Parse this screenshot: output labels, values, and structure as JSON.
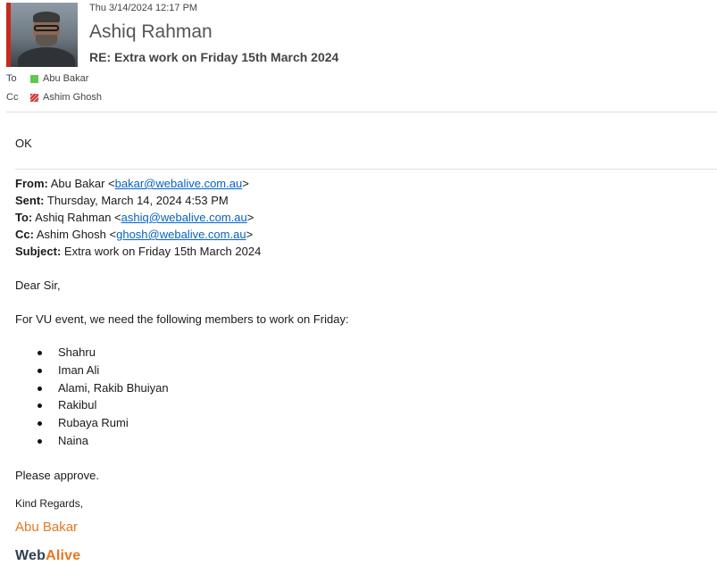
{
  "header": {
    "sent_date": "Thu 3/14/2024 12:17 PM",
    "sender_name": "Ashiq Rahman",
    "subject": "RE: Extra work on Friday 15th March 2024",
    "to_label": "To",
    "to_name": "Abu Bakar",
    "cc_label": "Cc",
    "cc_name": "Ashim Ghosh",
    "presence_colors": {
      "to": "#5cc94a",
      "cc": "#d13438"
    }
  },
  "reply": {
    "text": "OK"
  },
  "quoted": {
    "from_label": "From:",
    "from_name": "Abu Bakar <",
    "from_email": "bakar@webalive.com.au",
    "from_close": ">",
    "sent_label": "Sent:",
    "sent_value": "Thursday, March 14, 2024 4:53 PM",
    "to_label": "To:",
    "to_name": "Ashiq Rahman <",
    "to_email": "ashiq@webalive.com.au",
    "to_close": ">",
    "cc_label": "Cc:",
    "cc_name": "Ashim Ghosh <",
    "cc_email": "ghosh@webalive.com.au",
    "cc_close": ">",
    "subject_label": "Subject:",
    "subject_value": "Extra work on Friday 15th March 2024"
  },
  "message": {
    "greeting": "Dear Sir,",
    "intro": "For VU event, we need the following members to work on Friday:",
    "members": [
      "Shahru",
      "Iman Ali",
      "Alami, Rakib Bhuiyan",
      "Rakibul",
      "Rubaya Rumi",
      "Naina"
    ],
    "closing": "Please approve.",
    "regards": "Kind Regards,",
    "signature_name": "Abu Bakar",
    "logo_part1": "Web",
    "logo_part2": "Alive"
  },
  "colors": {
    "accent_red": "#c42b1c",
    "link_blue": "#0563c1",
    "brand_orange": "#e87722",
    "brand_dark": "#2f3e4d"
  }
}
